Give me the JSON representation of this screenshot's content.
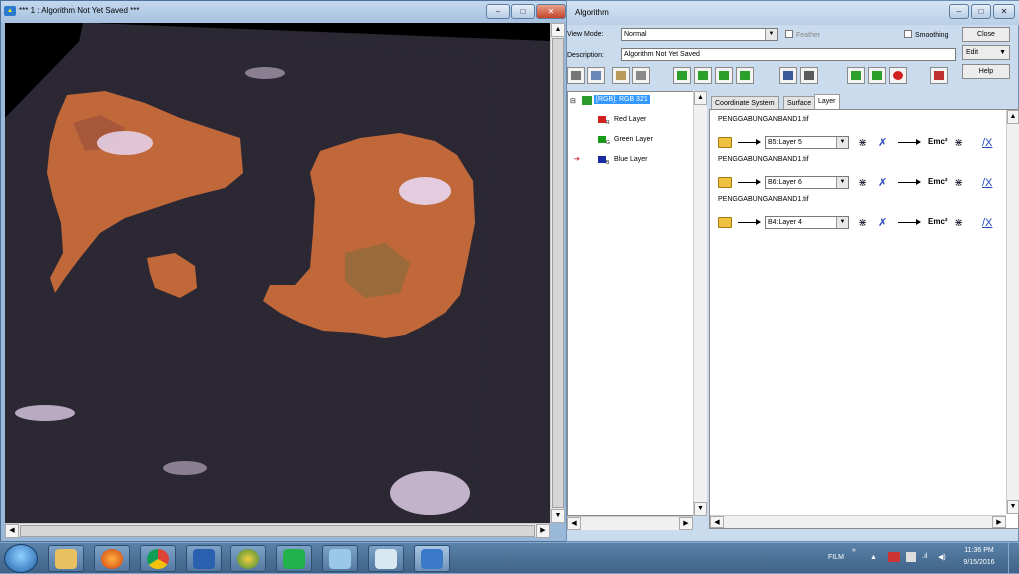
{
  "window1": {
    "title": "*** 1 : Algorithm Not Yet Saved ***",
    "controls": {
      "minimize": "–",
      "maximize": "□",
      "close": "✕"
    }
  },
  "window2": {
    "title": "Algorithm",
    "controls": {
      "minimize": "–",
      "maximize": "□",
      "close": "✕"
    },
    "view_mode_label": "View Mode:",
    "view_mode_value": "Normal",
    "feather_label": "Feather",
    "smoothing_label": "Smoothing",
    "close_button": "Close",
    "description_label": "Description:",
    "description_value": "Algorithm Not Yet Saved",
    "edit_button": "Edit",
    "help_button": "Help",
    "tree": {
      "root": "[RGB]: RGB 321",
      "children": [
        "Red Layer",
        "Green Layer",
        "Blue Layer"
      ],
      "sub_tags": [
        "R",
        "G",
        "B"
      ]
    },
    "tabs": [
      "Coordinate System",
      "Surface",
      "Layer"
    ],
    "active_tab": "Layer",
    "layers": [
      {
        "file": "PENGGABUNGANBAND1.tif",
        "band": "B5:Layer 5"
      },
      {
        "file": "PENGGABUNGANBAND1.tif",
        "band": "B6:Layer 6"
      },
      {
        "file": "PENGGABUNGANBAND1.tif",
        "band": "B4:Layer 4"
      }
    ],
    "formula_label": "Emc²"
  },
  "taskbar": {
    "film_label": "FILM",
    "expand": "»",
    "time": "11:36 PM",
    "date": "9/15/2016"
  },
  "colors": {
    "land": "#c0683a",
    "sea": "#2b2833",
    "cloud": "#e8d6f0",
    "selection": "#3399ff"
  }
}
